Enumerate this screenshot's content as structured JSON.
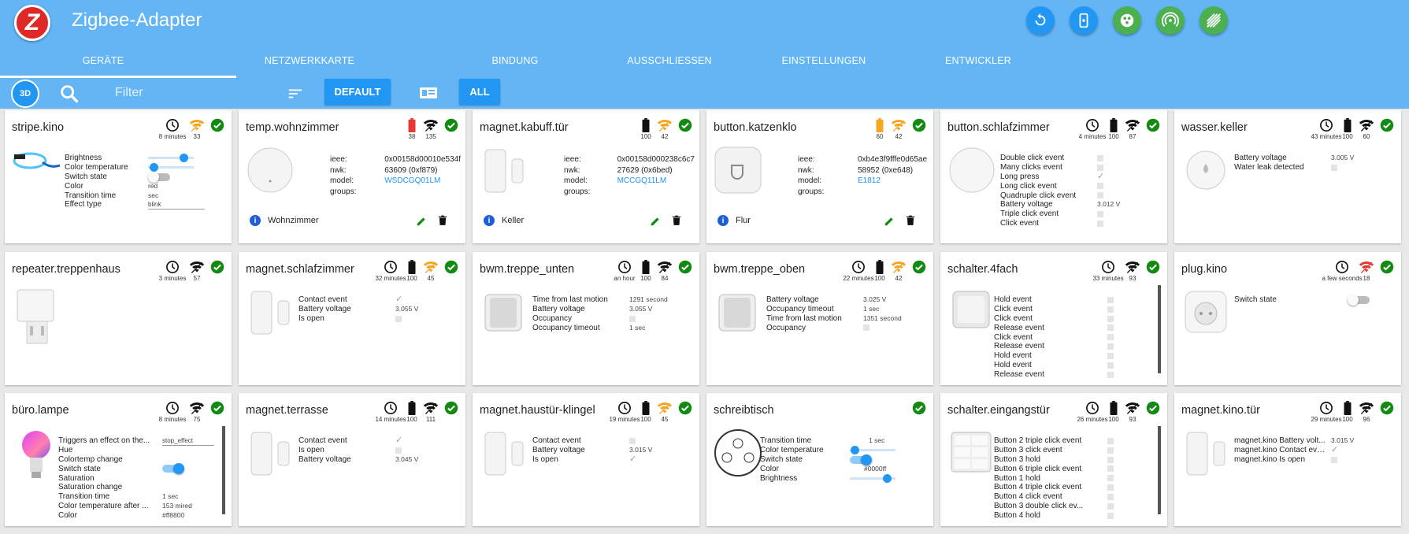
{
  "app": {
    "title": "Zigbee-Adapter",
    "logo_letter": "Z"
  },
  "header_actions": [
    {
      "name": "refresh-icon",
      "color": "#2196f3"
    },
    {
      "name": "pair-device-icon",
      "color": "#2196f3"
    },
    {
      "name": "touchlink-icon",
      "color": "#4caf50"
    },
    {
      "name": "permit-join-icon",
      "color": "#4caf50"
    },
    {
      "name": "network-map-icon",
      "color": "#4caf50"
    }
  ],
  "tabs": [
    "GERÄTE",
    "NETZWERKKARTE",
    "BINDUNG",
    "AUSSCHLIESSEN",
    "EINSTELLUNGEN",
    "ENTWICKLER"
  ],
  "toolbar": {
    "btn_3d": "3D",
    "filter_placeholder": "Filter",
    "default_label": "DEFAULT",
    "all_label": "ALL"
  },
  "colors": {
    "header": "#64b5f6",
    "accent": "#2196f3",
    "ok": "#138b13",
    "warn": "#f5a623",
    "error": "#e53935"
  },
  "devices": [
    {
      "name": "stripe.kino",
      "time": "8 minutes",
      "signal": "33",
      "signal_color": "#f5a623",
      "states": [
        "Brightness",
        "Color temperature",
        "Switch state",
        "Color",
        "Transition time",
        "Effect type"
      ],
      "values": {
        "color": "red",
        "transition": "sec",
        "effect": "blink",
        "brightness": 0.85,
        "colortemp": 0.05,
        "switch": false
      }
    },
    {
      "name": "temp.wohnzimmer",
      "battery": "38",
      "battery_color": "#e53935",
      "signal": "135",
      "signal_color": "#111",
      "ieee": "0x00158d00010e534f",
      "nwk": "63609 (0xf879)",
      "model": "WSDCGQ01LM",
      "groups": "",
      "location": "Wohnzimmer"
    },
    {
      "name": "magnet.kabuff.tür",
      "battery": "100",
      "battery_color": "#111",
      "signal": "42",
      "signal_color": "#f5a623",
      "ieee": "0x00158d000238c6c7",
      "nwk": "27629 (0x6bed)",
      "model": "MCCGQ11LM",
      "groups": "",
      "location": "Keller"
    },
    {
      "name": "button.katzenklo",
      "battery": "60",
      "battery_color": "#f5a623",
      "signal": "42",
      "signal_color": "#f5a623",
      "ieee": "0xb4e3f9fffe0d65ae",
      "nwk": "58952 (0xe648)",
      "model": "E1812",
      "groups": "",
      "location": "Flur"
    },
    {
      "name": "button.schlafzimmer",
      "time": "4 minutes",
      "battery": "100",
      "battery_color": "#111",
      "signal": "87",
      "signal_color": "#111",
      "states": [
        "Double click event",
        "Many clicks event",
        "Long press",
        "Long click event",
        "Quadruple click event",
        "Battery voltage",
        "Triple click event",
        "Click event"
      ],
      "values": {
        "voltage": "3.012 V"
      }
    },
    {
      "name": "wasser.keller",
      "time": "43 minutes",
      "battery": "100",
      "battery_color": "#111",
      "signal": "60",
      "signal_color": "#111",
      "states": [
        "Battery voltage",
        "Water leak detected"
      ],
      "values": {
        "voltage": "3.005 V"
      }
    },
    {
      "name": "repeater.treppenhaus",
      "time": "3 minutes",
      "signal": "57",
      "signal_color": "#111"
    },
    {
      "name": "magnet.schlafzimmer",
      "time": "32 minutes",
      "battery": "100",
      "battery_color": "#111",
      "signal": "45",
      "signal_color": "#f5a623",
      "states": [
        "Contact event",
        "Battery voltage",
        "Is open"
      ],
      "values": {
        "voltage": "3.055 V"
      }
    },
    {
      "name": "bwm.treppe_unten",
      "time": "an hour",
      "battery": "100",
      "battery_color": "#111",
      "signal": "84",
      "signal_color": "#111",
      "states": [
        "Time from last motion",
        "Battery voltage",
        "Occupancy",
        "Occupancy timeout"
      ],
      "values": {
        "last_motion": "1291 second",
        "voltage": "3.055 V",
        "timeout": "1 sec"
      }
    },
    {
      "name": "bwm.treppe_oben",
      "time": "22 minutes",
      "battery": "100",
      "battery_color": "#111",
      "signal": "42",
      "signal_color": "#f5a623",
      "states": [
        "Battery voltage",
        "Occupancy timeout",
        "Time from last motion",
        "Occupancy"
      ],
      "values": {
        "voltage": "3.025 V",
        "timeout": "1 sec",
        "last_motion": "1351 second"
      }
    },
    {
      "name": "schalter.4fach",
      "time": "33 minutes",
      "signal": "93",
      "signal_color": "#111",
      "states": [
        "Hold event",
        "Click event",
        "Click event",
        "Release event",
        "Click event",
        "Release event",
        "Hold event",
        "Hold event",
        "Release event"
      ]
    },
    {
      "name": "plug.kino",
      "time": "a few seconds",
      "signal": "18",
      "signal_color": "#e53935",
      "states": [
        "Switch state"
      ],
      "values": {
        "switch": false
      }
    },
    {
      "name": "büro.lampe",
      "time": "8 minutes",
      "signal": "75",
      "signal_color": "#111",
      "states": [
        "Triggers an effect on the...",
        "Hue",
        "Colortemp change",
        "Switch state",
        "Saturation",
        "Saturation change",
        "Transition time",
        "Color temperature after ...",
        "Color"
      ],
      "values": {
        "effect": "stop_effect",
        "switch": true,
        "transition": "1 sec",
        "colortemp": "153 mired",
        "color": "#ff8800"
      }
    },
    {
      "name": "magnet.terrasse",
      "time": "14 minutes",
      "battery": "100",
      "battery_color": "#111",
      "signal": "111",
      "signal_color": "#111",
      "states": [
        "Contact event",
        "Is open",
        "Battery voltage"
      ],
      "values": {
        "voltage": "3.045 V"
      }
    },
    {
      "name": "magnet.haustür-klingel",
      "time": "19 minutes",
      "battery": "100",
      "battery_color": "#111",
      "signal": "45",
      "signal_color": "#f5a623",
      "states": [
        "Contact event",
        "Battery voltage",
        "Is open"
      ],
      "values": {
        "voltage": "3.015 V"
      }
    },
    {
      "name": "schreibtisch",
      "states": [
        "Transition time",
        "Color temperature",
        "Switch state",
        "Color",
        "Brightness"
      ],
      "values": {
        "transition": "1 sec",
        "color": "#0000ff",
        "switch": true,
        "colortemp": 0.02,
        "brightness": 0.9
      }
    },
    {
      "name": "schalter.eingangstür",
      "time": "26 minutes",
      "battery": "100",
      "battery_color": "#111",
      "signal": "93",
      "signal_color": "#111",
      "states": [
        "Button 2 triple click event",
        "Button 3 click event",
        "Button 3 hold",
        "Button 6 triple click event",
        "Button 1 hold",
        "Button 4 triple click event",
        "Button 4 click event",
        "Button 3 double click ev...",
        "Button 4 hold"
      ]
    },
    {
      "name": "magnet.kino.tür",
      "time": "29 minutes",
      "battery": "100",
      "battery_color": "#111",
      "signal": "96",
      "signal_color": "#111",
      "states": [
        "magnet.kino Battery volt...",
        "magnet.kino Contact event",
        "magnet.kino Is open"
      ],
      "values": {
        "voltage": "3.015 V"
      }
    }
  ]
}
